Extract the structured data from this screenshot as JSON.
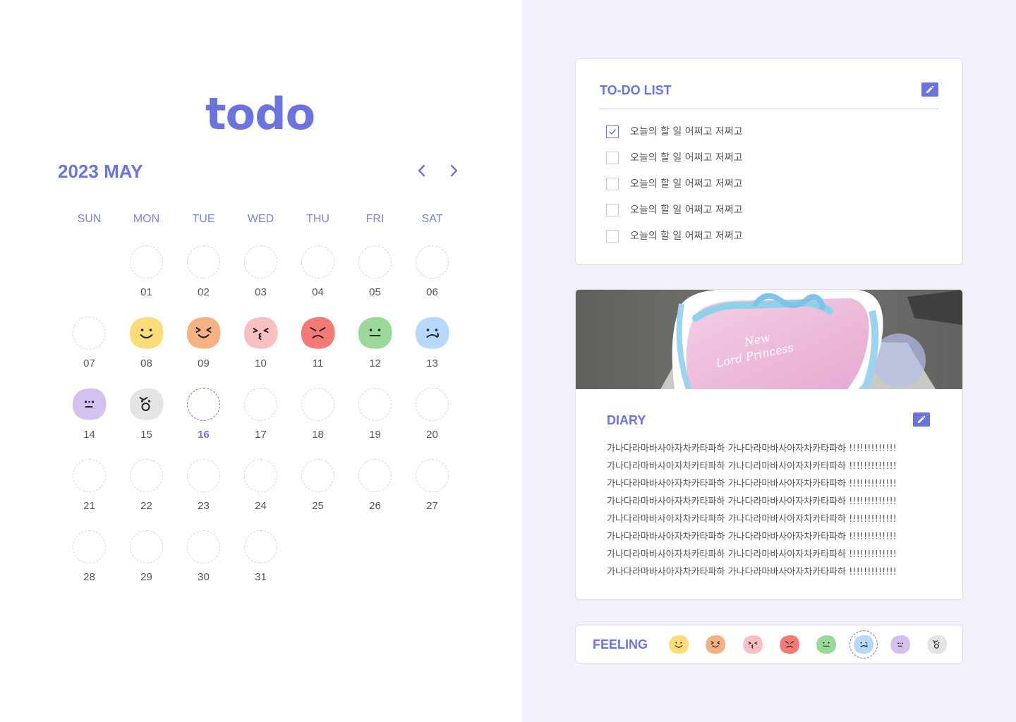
{
  "logo": "todo",
  "calendar": {
    "title": "2023 MAY",
    "weekdays": [
      "SUN",
      "MON",
      "TUE",
      "WED",
      "THU",
      "FRI",
      "SAT"
    ],
    "today": "16",
    "days": [
      {
        "label": "01",
        "col": 1,
        "row": 0,
        "mood": null
      },
      {
        "label": "02",
        "col": 2,
        "row": 0,
        "mood": null
      },
      {
        "label": "03",
        "col": 3,
        "row": 0,
        "mood": null
      },
      {
        "label": "04",
        "col": 4,
        "row": 0,
        "mood": null
      },
      {
        "label": "05",
        "col": 5,
        "row": 0,
        "mood": null
      },
      {
        "label": "06",
        "col": 6,
        "row": 0,
        "mood": null
      },
      {
        "label": "07",
        "col": 0,
        "row": 1,
        "mood": null
      },
      {
        "label": "08",
        "col": 1,
        "row": 1,
        "mood": "happy"
      },
      {
        "label": "09",
        "col": 2,
        "row": 1,
        "mood": "laughing"
      },
      {
        "label": "10",
        "col": 3,
        "row": 1,
        "mood": "kiss"
      },
      {
        "label": "11",
        "col": 4,
        "row": 1,
        "mood": "angry"
      },
      {
        "label": "12",
        "col": 5,
        "row": 1,
        "mood": "neutral"
      },
      {
        "label": "13",
        "col": 6,
        "row": 1,
        "mood": "crying"
      },
      {
        "label": "14",
        "col": 0,
        "row": 2,
        "mood": "sad"
      },
      {
        "label": "15",
        "col": 1,
        "row": 2,
        "mood": "surprised"
      },
      {
        "label": "16",
        "col": 2,
        "row": 2,
        "mood": null
      },
      {
        "label": "17",
        "col": 3,
        "row": 2,
        "mood": null
      },
      {
        "label": "18",
        "col": 4,
        "row": 2,
        "mood": null
      },
      {
        "label": "19",
        "col": 5,
        "row": 2,
        "mood": null
      },
      {
        "label": "20",
        "col": 6,
        "row": 2,
        "mood": null
      },
      {
        "label": "21",
        "col": 0,
        "row": 3,
        "mood": null
      },
      {
        "label": "22",
        "col": 1,
        "row": 3,
        "mood": null
      },
      {
        "label": "23",
        "col": 2,
        "row": 3,
        "mood": null
      },
      {
        "label": "24",
        "col": 3,
        "row": 3,
        "mood": null
      },
      {
        "label": "25",
        "col": 4,
        "row": 3,
        "mood": null
      },
      {
        "label": "26",
        "col": 5,
        "row": 3,
        "mood": null
      },
      {
        "label": "27",
        "col": 6,
        "row": 3,
        "mood": null
      },
      {
        "label": "28",
        "col": 0,
        "row": 4,
        "mood": null
      },
      {
        "label": "29",
        "col": 1,
        "row": 4,
        "mood": null
      },
      {
        "label": "30",
        "col": 2,
        "row": 4,
        "mood": null
      },
      {
        "label": "31",
        "col": 3,
        "row": 4,
        "mood": null
      }
    ]
  },
  "todo": {
    "title": "TO-DO LIST",
    "items": [
      {
        "text": "오늘의 할 일 어쩌고 저쩌고",
        "checked": true
      },
      {
        "text": "오늘의 할 일 어쩌고 저쩌고",
        "checked": false
      },
      {
        "text": "오늘의 할 일 어쩌고 저쩌고",
        "checked": false
      },
      {
        "text": "오늘의 할 일 어쩌고 저쩌고",
        "checked": false
      },
      {
        "text": "오늘의 할 일 어쩌고 저쩌고",
        "checked": false
      }
    ]
  },
  "diary": {
    "title": "DIARY",
    "lines": [
      "가나다라마바사아자차카타파하 가나다라마바사아자차카타파하 !!!!!!!!!!!!!",
      "가나다라마바사아자차카타파하 가나다라마바사아자차카타파하 !!!!!!!!!!!!!",
      "가나다라마바사아자차카타파하 가나다라마바사아자차카타파하 !!!!!!!!!!!!!",
      "가나다라마바사아자차카타파하 가나다라마바사아자차카타파하 !!!!!!!!!!!!!",
      "가나다라마바사아자차카타파하 가나다라마바사아자차카타파하 !!!!!!!!!!!!!",
      "가나다라마바사아자차카타파하 가나다라마바사아자차카타파하 !!!!!!!!!!!!!",
      "가나다라마바사아자차카타파하 가나다라마바사아자차카타파하 !!!!!!!!!!!!!",
      "가나다라마바사아자차카타파하 가나다라마바사아자차카타파하 !!!!!!!!!!!!!"
    ]
  },
  "feeling": {
    "title": "FEELING",
    "moods": [
      "happy",
      "laughing",
      "kiss",
      "angry",
      "neutral",
      "crying",
      "sad",
      "surprised"
    ],
    "selected": "crying"
  },
  "colors": {
    "accent": "#6b73df",
    "happy": "#fbdc78",
    "laughing": "#f5b184",
    "kiss": "#f9c0c2",
    "angry": "#f47a78",
    "neutral": "#9bd99b",
    "crying": "#b6d8fb",
    "sad": "#d3c2ef",
    "surprised": "#e4e4e4"
  }
}
